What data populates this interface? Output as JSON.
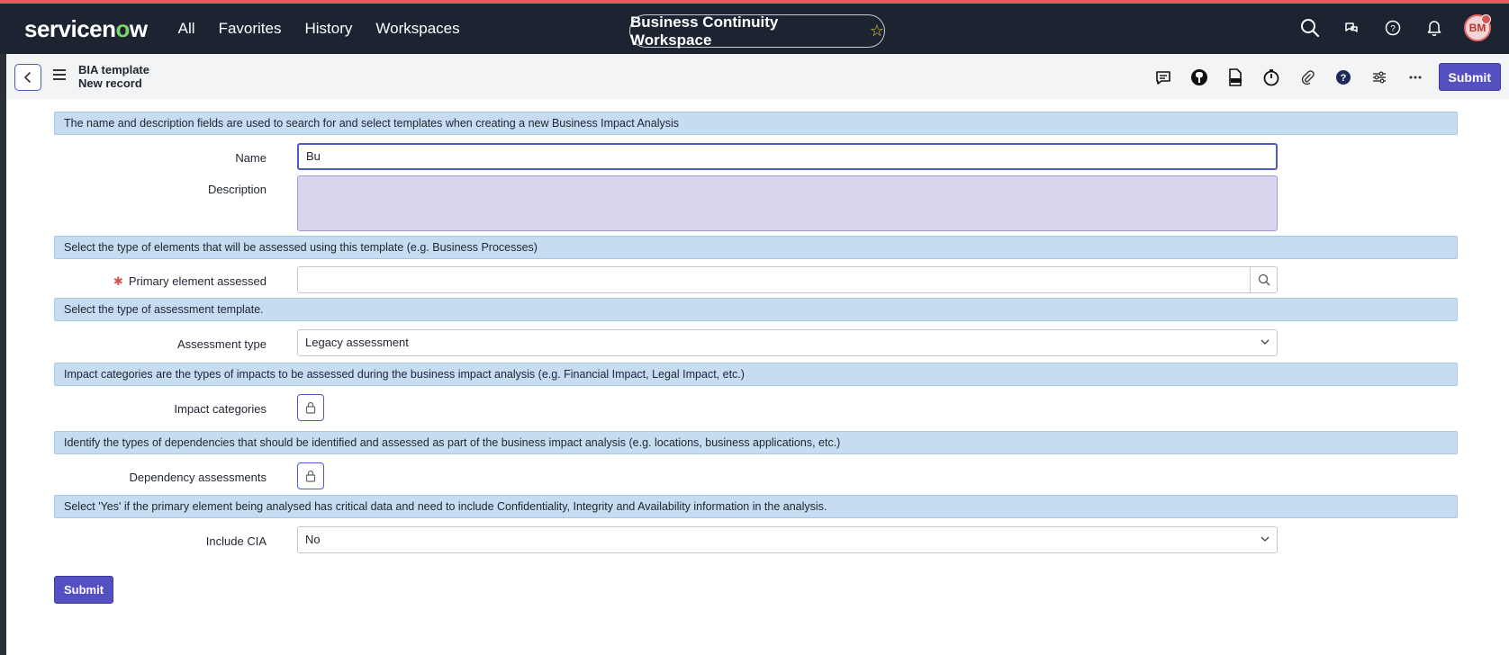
{
  "nav": {
    "logo_pre": "servicen",
    "logo_o": "o",
    "logo_post": "w",
    "links": [
      "All",
      "Favorites",
      "History",
      "Workspaces"
    ],
    "workspace_title": "Business Continuity Workspace",
    "avatar_initials": "BM"
  },
  "record": {
    "title": "BIA template",
    "subtitle": "New record",
    "submit_label": "Submit"
  },
  "form": {
    "sections": [
      "The name and description fields are used to search for and select templates when creating a new Business Impact Analysis",
      "Select the type of elements that will be assessed using this template (e.g. Business Processes)",
      "Select the type of assessment template.",
      "Impact categories are the types of impacts to be assessed during the business impact analysis (e.g. Financial Impact, Legal Impact, etc.)",
      "Identify the types of dependencies that should be identified and assessed as part of the business impact analysis (e.g. locations, business applications, etc.)",
      "Select 'Yes' if the primary element being analysed has critical data and need to include Confidentiality, Integrity and Availability information in the analysis."
    ],
    "name_label": "Name",
    "name_value": "Bu",
    "description_label": "Description",
    "description_value": "",
    "primary_label": "Primary element assessed",
    "primary_required_mark": "✱",
    "primary_value": "",
    "assessment_label": "Assessment type",
    "assessment_value": "Legacy assessment",
    "impact_label": "Impact categories",
    "dependency_label": "Dependency assessments",
    "cia_label": "Include CIA",
    "cia_value": "No",
    "submit_label": "Submit"
  },
  "colors": {
    "topbar": "#1c2431",
    "accent": "#5550c2",
    "section_bg": "#c6dcf0",
    "logo_o": "#7fd36b"
  }
}
